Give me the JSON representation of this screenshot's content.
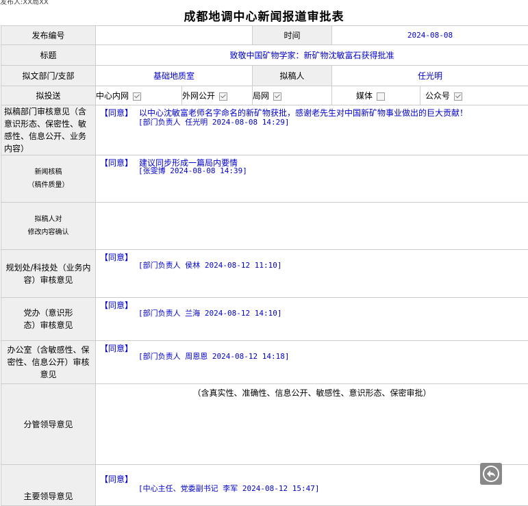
{
  "top_fragment": "发布人:XX局XX",
  "page_title": "成都地调中心新闻报道审批表",
  "row1": {
    "label_id": "发布编号",
    "id_value": "",
    "label_time": "时间",
    "time_value": "2024-08-08"
  },
  "row2": {
    "label": "标题",
    "value": "致敬中国矿物学家：新矿物沈敏富石获得批准"
  },
  "row3": {
    "label_dept": "拟文部门/支部",
    "dept_value": "基础地质室",
    "label_drafter": "拟稿人",
    "drafter_value": "任光明"
  },
  "row4": {
    "label": "拟投送",
    "targets": [
      {
        "name": "中心内网",
        "checked": true
      },
      {
        "name": "外网公开",
        "checked": true
      },
      {
        "name": "局网",
        "checked": true
      },
      {
        "name": "媒体",
        "checked": false
      },
      {
        "name": "公众号",
        "checked": true
      }
    ]
  },
  "dept_review": {
    "label": "拟稿部门审核意见（含意识形态、保密性、敏感性、信息公开、业务内容）",
    "agree": "【同意】",
    "text": "以中心沈敏富老师名字命名的新矿物获批，感谢老先生对中国新矿物事业做出的巨大贡献！",
    "sign": "[部门负责人 任光明 2024-08-08 14:29]"
  },
  "news_review": {
    "label_line1": "新闻核稿",
    "label_line2": "（稿件质量）",
    "agree": "【同意】",
    "text": "建议同步形成一篇局内要情",
    "sign": "[张雯博 2024-08-08 14:39]"
  },
  "drafter_confirm": {
    "label_line1": "拟稿人对",
    "label_line2": "修改内容确认"
  },
  "planning_review": {
    "label": "规划处/科技处（业务内容）审核意见",
    "agree": "【同意】",
    "sign": "[部门负责人 侯林 2024-08-12 11:10]"
  },
  "party_review": {
    "label": "党办（意识形态）审核意见",
    "agree": "【同意】",
    "sign": "[部门负责人 兰海 2024-08-12 14:10]"
  },
  "office_review": {
    "label": "办公室（含敏感性、保密性、信息公开）审核意见",
    "agree": "【同意】",
    "sign": "[部门负责人 周恩恩 2024-08-12 14:18]"
  },
  "leader_review": {
    "label": "分管领导意见",
    "note": "（含真实性、准确性、信息公开、敏感性、意识形态、保密审批）"
  },
  "main_leader": {
    "label": "主要领导意见",
    "agree": "【同意】",
    "sign": "[中心主任、党委副书记 李军 2024-08-12 15:47]"
  },
  "colors": {
    "link_blue": "#0000cc",
    "label_bg": "#efefef",
    "border": "#cccccc"
  },
  "icons": {
    "back": "back-arrow-icon",
    "check": "check-icon"
  }
}
